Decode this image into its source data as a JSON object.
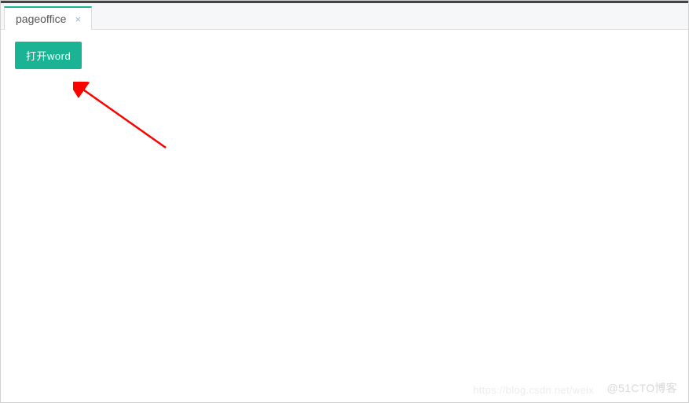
{
  "tabs": [
    {
      "label": "pageoffice"
    }
  ],
  "actions": {
    "open_word_label": "打开word"
  },
  "watermark": {
    "primary": "@51CTO博客",
    "secondary": "https://blog.csdn.net/weix"
  }
}
